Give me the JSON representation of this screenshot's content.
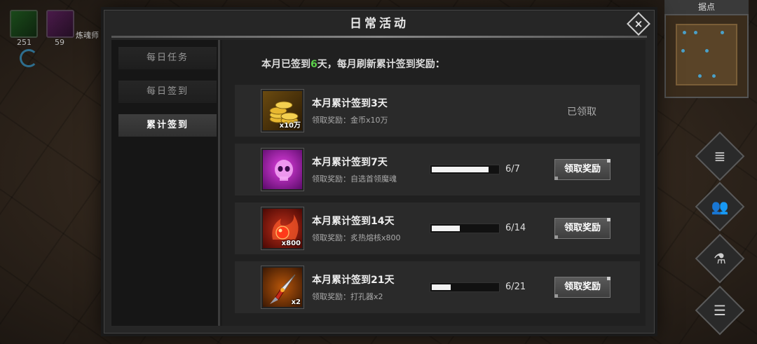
{
  "hud": {
    "skill1_count": "251",
    "skill2_count": "59",
    "player_name": "炼魂师",
    "minimap_label": "据点"
  },
  "side_buttons": [
    "scroll-icon",
    "party-icon",
    "potion-icon",
    "menu-list-icon"
  ],
  "dialog": {
    "title": "日常活动",
    "close_icon": "×",
    "tabs": [
      {
        "label": "每日任务",
        "active": false
      },
      {
        "label": "每日签到",
        "active": false
      },
      {
        "label": "累计签到",
        "active": true
      }
    ],
    "header": {
      "prefix": "本月已签到",
      "days": "6",
      "suffix": "天，每月刷新累计签到奖励："
    },
    "rewards": [
      {
        "title": "本月累计签到3天",
        "desc": "领取奖励：金币x10万",
        "icon": "gold-coins-icon",
        "qty": "x10万",
        "status": "claimed",
        "status_text": "已领取"
      },
      {
        "title": "本月累计签到7天",
        "desc": "领取奖励：自选首领魔魂",
        "icon": "skull-soul-icon",
        "qty": "",
        "progress_text": "6/7",
        "progress": 0.857,
        "button": "领取奖励"
      },
      {
        "title": "本月累计签到14天",
        "desc": "领取奖励：炙热熔核x800",
        "icon": "fire-core-icon",
        "qty": "x800",
        "progress_text": "6/14",
        "progress": 0.429,
        "button": "领取奖励"
      },
      {
        "title": "本月累计签到21天",
        "desc": "领取奖励：打孔器x2",
        "icon": "drill-icon",
        "qty": "x2",
        "progress_text": "6/21",
        "progress": 0.286,
        "button": "领取奖励"
      }
    ]
  },
  "colors": {
    "highlight_green": "#5bd04a",
    "progress_fill": "#f2f2f2"
  }
}
